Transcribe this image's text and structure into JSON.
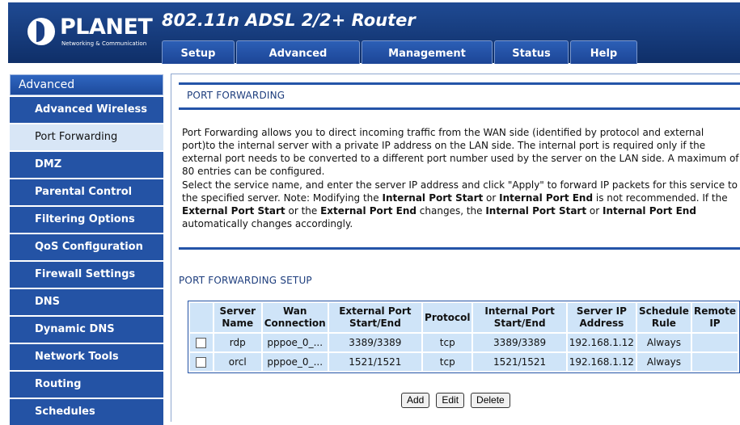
{
  "header": {
    "logo_text": "PLANET",
    "logo_subtitle": "Networking & Communication",
    "product_title": "802.11n ADSL 2/2+ Router",
    "tabs": [
      {
        "label": "Setup"
      },
      {
        "label": "Advanced"
      },
      {
        "label": "Management"
      },
      {
        "label": "Status"
      },
      {
        "label": "Help"
      }
    ]
  },
  "sidebar": {
    "title": "Advanced",
    "items": [
      {
        "label": "Advanced Wireless"
      },
      {
        "label": "Port Forwarding"
      },
      {
        "label": "DMZ"
      },
      {
        "label": "Parental Control"
      },
      {
        "label": "Filtering Options"
      },
      {
        "label": "QoS Configuration"
      },
      {
        "label": "Firewall Settings"
      },
      {
        "label": "DNS"
      },
      {
        "label": "Dynamic DNS"
      },
      {
        "label": "Network Tools"
      },
      {
        "label": "Routing"
      },
      {
        "label": "Schedules"
      }
    ]
  },
  "main": {
    "title": "PORT FORWARDING",
    "description_1": "Port Forwarding allows you to direct incoming traffic from the WAN side (identified by protocol and external port)to the internal server with a private IP address on the LAN side. The internal port is required only if the external port needs to be converted to a different port number used by the server on the LAN side. A maximum of 80 entries can be configured.",
    "description_2": {
      "part1": "Select the service name, and enter the server IP address and click \"Apply\" to forward IP packets for this service to the specified server. Note: Modifying the ",
      "b1": "Internal Port Start",
      "part2": " or ",
      "b2": "Internal Port End",
      "part3": " is not recommended. If the ",
      "b3": "External Port Start",
      "part4": " or the ",
      "b4": "External Port End",
      "part5": " changes, the ",
      "b5": "Internal Port Start",
      "part6": " or ",
      "b6": "Internal Port End",
      "part7": " automatically changes accordingly."
    },
    "setup_title": "PORT FORWARDING SETUP",
    "table": {
      "headers": [
        "",
        "Server Name",
        "Wan Connection",
        "External Port Start/End",
        "Protocol",
        "Internal Port Start/End",
        "Server IP Address",
        "Schedule Rule",
        "Remote IP"
      ],
      "rows": [
        {
          "server_name": "rdp",
          "wan": "pppoe_0_...",
          "external": "3389/3389",
          "protocol": "tcp",
          "internal": "3389/3389",
          "server_ip": "192.168.1.12",
          "schedule": "Always",
          "remote_ip": ""
        },
        {
          "server_name": "orcl",
          "wan": "pppoe_0_...",
          "external": "1521/1521",
          "protocol": "tcp",
          "internal": "1521/1521",
          "server_ip": "192.168.1.12",
          "schedule": "Always",
          "remote_ip": ""
        }
      ]
    },
    "buttons": {
      "add": "Add",
      "edit": "Edit",
      "delete": "Delete"
    }
  },
  "colors": {
    "brand_blue": "#1f4a93",
    "sidebar_blue": "#2453a5",
    "active_item_bg": "#d8e6f6",
    "table_cell_bg": "#cfe4f8"
  }
}
